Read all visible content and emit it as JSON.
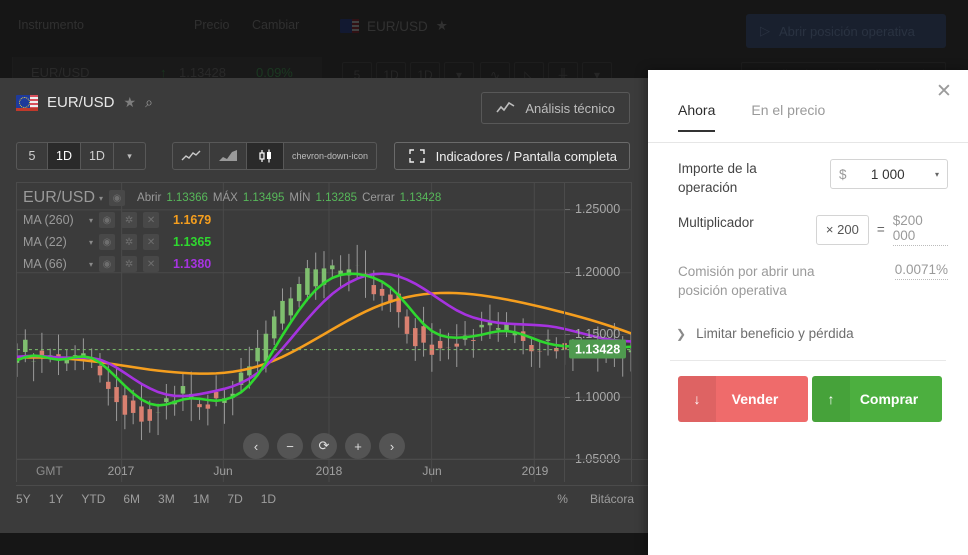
{
  "background": {
    "watchlist_headers": [
      "Instrumento",
      "Precio",
      "Cambiar"
    ],
    "watchlist_row": {
      "symbol": "EUR/USD",
      "arrow": "↑",
      "price": "1.13428",
      "change": "0.09%"
    },
    "symbol_label": "EUR/USD",
    "star": "★",
    "open_position_button": "Abrir posición operativa",
    "play_icon": "▷",
    "chips": [
      "5",
      "1D",
      "1D",
      "▾"
    ],
    "chips2": [
      "",
      "",
      "",
      "▾"
    ],
    "indicators_button": "Indicadores / Pantalla completa"
  },
  "chart": {
    "symbol": "EUR/USD",
    "star_icon": "★",
    "search_icon": "⌕",
    "technical_analysis_button": "Análisis técnico",
    "indicators_button": "Indicadores / Pantalla completa",
    "timeframe_segments": [
      {
        "label": "5",
        "active": false
      },
      {
        "label": "1D",
        "active": true
      },
      {
        "label": "1D",
        "active": false
      },
      {
        "label": "▾",
        "active": false
      }
    ],
    "charttype_segments": [
      {
        "icon": "line-chart-icon",
        "active": false
      },
      {
        "icon": "area-chart-icon",
        "active": false
      },
      {
        "icon": "candlestick-chart-icon",
        "active": true
      },
      {
        "icon": "chevron-down-icon",
        "active": false
      }
    ],
    "legend_title": "EUR/USD",
    "legend_caret": "▾",
    "ohlc": [
      {
        "label": "Abrir",
        "value": "1.13366"
      },
      {
        "label": "MÁX",
        "value": "1.13495"
      },
      {
        "label": "MÍN",
        "value": "1.13285"
      },
      {
        "label": "Cerrar",
        "value": "1.13428"
      }
    ],
    "indicators": [
      {
        "name": "MA (260)",
        "value": "1.1679",
        "color": "#f59e1e"
      },
      {
        "name": "MA (22)",
        "value": "1.1365",
        "color": "#2fd82f"
      },
      {
        "name": "MA (66)",
        "value": "1.1380",
        "color": "#a633e0"
      }
    ],
    "indicator_icons": [
      "eye-icon",
      "gear-icon",
      "close-icon"
    ],
    "eye_glyph": "◉",
    "gear_glyph": "✲",
    "close_glyph": "✕",
    "y_ticks": [
      "1.25000",
      "1.20000",
      "1.15000",
      "1.10000",
      "1.05000"
    ],
    "current_price": "1.13428",
    "x_ticks": [
      "2017",
      "Jun",
      "2018",
      "Jun",
      "2019"
    ],
    "timezone": "GMT",
    "nav_buttons": [
      "‹",
      "−",
      "⟳",
      "+",
      "›"
    ],
    "ranges": [
      "5Y",
      "1Y",
      "YTD",
      "6M",
      "3M",
      "1M",
      "7D",
      "1D"
    ],
    "percent_toggle": "%",
    "log_label": "Bitácora"
  },
  "chart_data": {
    "type": "line",
    "title": "EUR/USD",
    "xlabel": "",
    "ylabel": "",
    "ylim": [
      1.028,
      1.268
    ],
    "y_ticks": [
      1.25,
      1.2,
      1.15,
      1.1,
      1.05
    ],
    "x_ticks": [
      "2017",
      "Jun",
      "2018",
      "Jun",
      "2019"
    ],
    "grid": true,
    "current_price": 1.13428,
    "series": [
      {
        "name": "MA (260)",
        "color": "#f59e1e",
        "values": [
          1.128,
          1.128,
          1.128,
          1.128,
          1.1278,
          1.1275,
          1.127,
          1.1265,
          1.1258,
          1.125,
          1.1242,
          1.1232,
          1.1222,
          1.1212,
          1.1202,
          1.1192,
          1.1182,
          1.1174,
          1.1167,
          1.1161,
          1.1156,
          1.1152,
          1.115,
          1.115,
          1.1152,
          1.1157,
          1.1165,
          1.1176,
          1.119,
          1.1208,
          1.123,
          1.1256,
          1.1285,
          1.1318,
          1.1353,
          1.139,
          1.1428,
          1.1466,
          1.1505,
          1.1543,
          1.158,
          1.1615,
          1.1648,
          1.1678,
          1.1705,
          1.1728,
          1.1748,
          1.1764,
          1.1777,
          1.1787,
          1.1793,
          1.1797,
          1.1798,
          1.1796,
          1.1792,
          1.1786,
          1.1778,
          1.1768,
          1.1757,
          1.1745,
          1.1732,
          1.1718,
          1.1703,
          1.1688,
          1.1672,
          1.1655,
          1.1638,
          1.162,
          1.1602,
          1.1583,
          1.1563,
          1.1542,
          1.152,
          1.1497,
          1.1473
        ]
      },
      {
        "name": "MA (66)",
        "color": "#a633e0",
        "values": [
          1.1285,
          1.129,
          1.1292,
          1.129,
          1.1285,
          1.128,
          1.1278,
          1.1278,
          1.1278,
          1.1275,
          1.1262,
          1.1235,
          1.1198,
          1.1155,
          1.111,
          1.1068,
          1.1032,
          1.1002,
          1.0982,
          1.0972,
          1.097,
          1.0975,
          1.0985,
          1.0998,
          1.1012,
          1.1028,
          1.1048,
          1.1075,
          1.111,
          1.1155,
          1.1212,
          1.1278,
          1.1352,
          1.143,
          1.151,
          1.1588,
          1.1662,
          1.173,
          1.179,
          1.184,
          1.188,
          1.1912,
          1.1935,
          1.1948,
          1.1952,
          1.1946,
          1.193,
          1.1905,
          1.1872,
          1.1832,
          1.1788,
          1.1742,
          1.1698,
          1.1658,
          1.1625,
          1.16,
          1.1582,
          1.1568,
          1.1558,
          1.1552,
          1.1548,
          1.1545,
          1.1542,
          1.1538,
          1.1532,
          1.1522,
          1.1508,
          1.1492,
          1.1475,
          1.1458,
          1.1442,
          1.1428,
          1.1418,
          1.1412,
          1.1408
        ]
      },
      {
        "name": "MA (22)",
        "color": "#2fd82f",
        "values": [
          1.1258,
          1.1282,
          1.1295,
          1.1288,
          1.1272,
          1.1262,
          1.1268,
          1.1282,
          1.1288,
          1.1275,
          1.1238,
          1.1182,
          1.1118,
          1.1052,
          1.0992,
          1.0942,
          1.0908,
          1.0895,
          1.0902,
          1.0922,
          1.0942,
          1.0952,
          1.0948,
          1.0938,
          1.0932,
          1.094,
          1.0962,
          1.1,
          1.1058,
          1.1138,
          1.1238,
          1.1348,
          1.1458,
          1.1562,
          1.166,
          1.1748,
          1.1822,
          1.1878,
          1.1918,
          1.1942,
          1.1952,
          1.195,
          1.1938,
          1.1918,
          1.1888,
          1.1842,
          1.1778,
          1.1702,
          1.1622,
          1.1548,
          1.1492,
          1.1458,
          1.1442,
          1.1438,
          1.1442,
          1.145,
          1.1462,
          1.1478,
          1.149,
          1.1492,
          1.1482,
          1.1462,
          1.1438,
          1.1412,
          1.1392,
          1.1378,
          1.137,
          1.1368,
          1.1372,
          1.1378,
          1.1382,
          1.138,
          1.1372,
          1.1362,
          1.1365
        ]
      }
    ]
  },
  "trade_panel": {
    "close_icon": "✕",
    "tabs": [
      {
        "label": "Ahora",
        "active": true
      },
      {
        "label": "En el precio",
        "active": false
      }
    ],
    "amount_label": "Importe de la operación",
    "amount_currency": "$",
    "amount_value": "1 000",
    "amount_caret": "▾",
    "multiplier_label": "Multiplicador",
    "multiplier_value": "× 200",
    "equals": "=",
    "notional_value": "$200 000",
    "commission_label": "Comisión por abrir una posición operativa",
    "commission_value": "0.0071%",
    "limit_chevron": "❯",
    "limit_label": "Limitar beneficio y pérdida",
    "sell_button": {
      "label": "Vender",
      "arrow": "↓",
      "color": "#ef6b6b"
    },
    "buy_button": {
      "label": "Comprar",
      "arrow": "↑",
      "color": "#4caf3f"
    }
  }
}
